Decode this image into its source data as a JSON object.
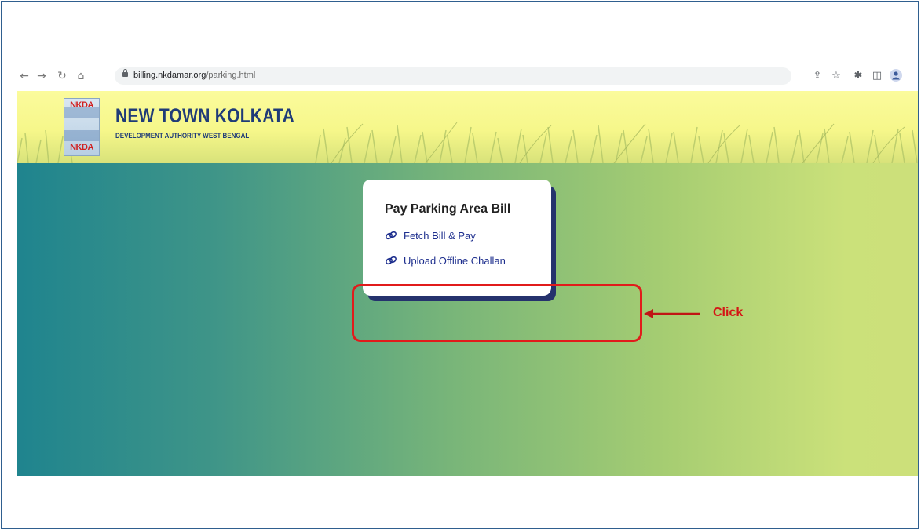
{
  "browser": {
    "url_domain": "billing.nkdamar.org",
    "url_path": "/parking.html",
    "icons": [
      "back-arrow-icon",
      "forward-arrow-icon",
      "reload-icon",
      "home-icon",
      "lock-icon",
      "share-icon",
      "bookmark-star-icon",
      "extensions-icon",
      "side-panel-icon",
      "profile-icon"
    ]
  },
  "header": {
    "logo_text": "NKDA",
    "title": "NEW TOWN KOLKATA",
    "subtitle": "DEVELOPMENT AUTHORITY WEST BENGAL"
  },
  "card": {
    "title": "Pay Parking Area Bill",
    "links": [
      {
        "label": "Fetch Bill & Pay",
        "icon": "link-icon"
      },
      {
        "label": "Upload Offline Challan",
        "icon": "link-icon"
      }
    ]
  },
  "annotation": {
    "label": "Click",
    "color": "#e11b1b"
  },
  "colors": {
    "brand": "#1f3b78",
    "link": "#1e2f8e",
    "card_shadow": "#25326d",
    "banner_start": "#1f848e",
    "banner_end": "#cce07a"
  }
}
